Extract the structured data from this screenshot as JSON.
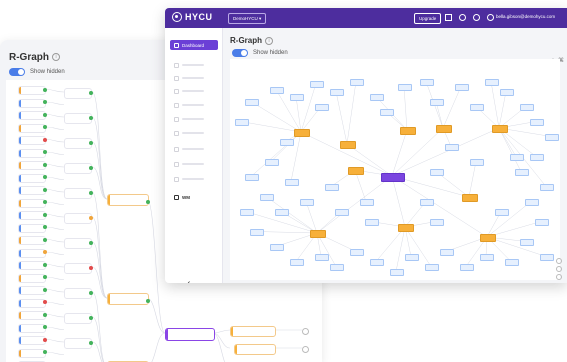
{
  "back_window": {
    "title": "R-Graph",
    "toggle_label": "Show hidden",
    "nodes_left": [
      "",
      "",
      "",
      "",
      "",
      "",
      "",
      "",
      "",
      "",
      "",
      "",
      "",
      "",
      "",
      "",
      "",
      "",
      "",
      "",
      "",
      "",
      ""
    ],
    "group_labels": {
      "node_a": "",
      "node_b": "",
      "node_c": "",
      "center": "",
      "right_1": "",
      "right_2": "",
      "right_3": ""
    }
  },
  "front_window": {
    "app_name": "HYCU",
    "tenant_select": "DemoHYCU",
    "upgrade_label": "Upgrade",
    "user_email": "bella.gibson@demohycu.com",
    "sidebar": [
      {
        "label": "Dashboard",
        "active": true
      },
      {
        "label": "",
        "active": false
      },
      {
        "label": "",
        "active": false
      },
      {
        "label": "",
        "active": false
      },
      {
        "label": "",
        "active": false
      },
      {
        "label": "",
        "active": false
      },
      {
        "label": "",
        "active": false
      },
      {
        "label": "",
        "active": false
      },
      {
        "label": "",
        "active": false
      },
      {
        "label": "",
        "active": false
      },
      {
        "label": "WM",
        "active": false
      }
    ],
    "collapse_icon": "chevron-left-icon",
    "page_title": "R-Graph",
    "toggle_label": "Show hidden"
  },
  "colors": {
    "brand_purple": "#4d2d9e",
    "active_purple": "#6b3fd6",
    "toggle_blue": "#4a7de8",
    "node_orange": "#f7b03a",
    "node_blue": "#e6f0fe",
    "status_green": "#43b35b",
    "status_red": "#e24b4b"
  }
}
